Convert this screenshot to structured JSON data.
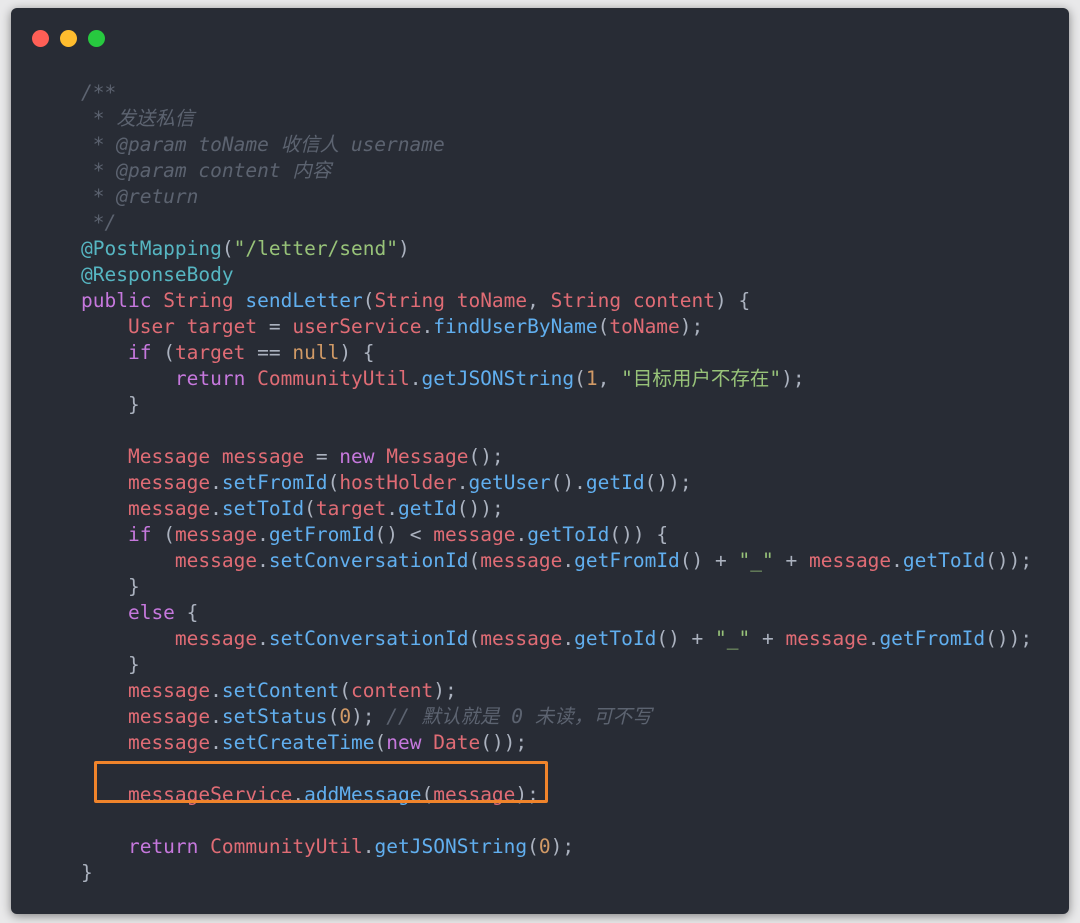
{
  "window": {
    "controls": [
      "close",
      "minimize",
      "maximize"
    ],
    "colors": {
      "close": "#ff5f56",
      "minimize": "#ffbd2e",
      "maximize": "#27c93f",
      "background": "#282c35",
      "highlight": "#f0842b"
    }
  },
  "code": {
    "lines": [
      [
        {
          "t": "/**",
          "c": "comment"
        }
      ],
      [
        {
          "t": " * 发送私信",
          "c": "comment"
        }
      ],
      [
        {
          "t": " * @param toName 收信人 username",
          "c": "comment"
        }
      ],
      [
        {
          "t": " * @param content 内容",
          "c": "comment"
        }
      ],
      [
        {
          "t": " * @return",
          "c": "comment"
        }
      ],
      [
        {
          "t": " */",
          "c": "comment"
        }
      ],
      [
        {
          "t": "@PostMapping",
          "c": "ann"
        },
        {
          "t": "(",
          "c": "punc"
        },
        {
          "t": "\"/letter/send\"",
          "c": "str"
        },
        {
          "t": ")",
          "c": "punc"
        }
      ],
      [
        {
          "t": "@ResponseBody",
          "c": "ann"
        }
      ],
      [
        {
          "t": "public ",
          "c": "kw"
        },
        {
          "t": "String ",
          "c": "type"
        },
        {
          "t": "sendLetter",
          "c": "fn"
        },
        {
          "t": "(",
          "c": "punc"
        },
        {
          "t": "String toName",
          "c": "type"
        },
        {
          "t": ", ",
          "c": "punc"
        },
        {
          "t": "String content",
          "c": "type"
        },
        {
          "t": ") {",
          "c": "punc"
        }
      ],
      [
        {
          "t": "    User target ",
          "c": "type"
        },
        {
          "t": "= ",
          "c": "punc"
        },
        {
          "t": "userService",
          "c": "type"
        },
        {
          "t": ".",
          "c": "punc"
        },
        {
          "t": "findUserByName",
          "c": "fn"
        },
        {
          "t": "(",
          "c": "punc"
        },
        {
          "t": "toName",
          "c": "type"
        },
        {
          "t": ");",
          "c": "punc"
        }
      ],
      [
        {
          "t": "    if ",
          "c": "kw"
        },
        {
          "t": "(",
          "c": "punc"
        },
        {
          "t": "target ",
          "c": "type"
        },
        {
          "t": "== ",
          "c": "punc"
        },
        {
          "t": "null",
          "c": "num"
        },
        {
          "t": ") {",
          "c": "punc"
        }
      ],
      [
        {
          "t": "        return ",
          "c": "kw"
        },
        {
          "t": "CommunityUtil",
          "c": "type"
        },
        {
          "t": ".",
          "c": "punc"
        },
        {
          "t": "getJSONString",
          "c": "fn"
        },
        {
          "t": "(",
          "c": "punc"
        },
        {
          "t": "1",
          "c": "num"
        },
        {
          "t": ", ",
          "c": "punc"
        },
        {
          "t": "\"目标用户不存在\"",
          "c": "str"
        },
        {
          "t": ");",
          "c": "punc"
        }
      ],
      [
        {
          "t": "    }",
          "c": "punc"
        }
      ],
      [],
      [
        {
          "t": "    Message message ",
          "c": "type"
        },
        {
          "t": "= ",
          "c": "punc"
        },
        {
          "t": "new ",
          "c": "kw"
        },
        {
          "t": "Message",
          "c": "type"
        },
        {
          "t": "();",
          "c": "punc"
        }
      ],
      [
        {
          "t": "    message",
          "c": "type"
        },
        {
          "t": ".",
          "c": "punc"
        },
        {
          "t": "setFromId",
          "c": "fn"
        },
        {
          "t": "(",
          "c": "punc"
        },
        {
          "t": "hostHolder",
          "c": "type"
        },
        {
          "t": ".",
          "c": "punc"
        },
        {
          "t": "getUser",
          "c": "fn"
        },
        {
          "t": "().",
          "c": "punc"
        },
        {
          "t": "getId",
          "c": "fn"
        },
        {
          "t": "());",
          "c": "punc"
        }
      ],
      [
        {
          "t": "    message",
          "c": "type"
        },
        {
          "t": ".",
          "c": "punc"
        },
        {
          "t": "setToId",
          "c": "fn"
        },
        {
          "t": "(",
          "c": "punc"
        },
        {
          "t": "target",
          "c": "type"
        },
        {
          "t": ".",
          "c": "punc"
        },
        {
          "t": "getId",
          "c": "fn"
        },
        {
          "t": "());",
          "c": "punc"
        }
      ],
      [
        {
          "t": "    if ",
          "c": "kw"
        },
        {
          "t": "(",
          "c": "punc"
        },
        {
          "t": "message",
          "c": "type"
        },
        {
          "t": ".",
          "c": "punc"
        },
        {
          "t": "getFromId",
          "c": "fn"
        },
        {
          "t": "() < ",
          "c": "punc"
        },
        {
          "t": "message",
          "c": "type"
        },
        {
          "t": ".",
          "c": "punc"
        },
        {
          "t": "getToId",
          "c": "fn"
        },
        {
          "t": "()) {",
          "c": "punc"
        }
      ],
      [
        {
          "t": "        message",
          "c": "type"
        },
        {
          "t": ".",
          "c": "punc"
        },
        {
          "t": "setConversationId",
          "c": "fn"
        },
        {
          "t": "(",
          "c": "punc"
        },
        {
          "t": "message",
          "c": "type"
        },
        {
          "t": ".",
          "c": "punc"
        },
        {
          "t": "getFromId",
          "c": "fn"
        },
        {
          "t": "() + ",
          "c": "punc"
        },
        {
          "t": "\"_\"",
          "c": "str"
        },
        {
          "t": " + ",
          "c": "punc"
        },
        {
          "t": "message",
          "c": "type"
        },
        {
          "t": ".",
          "c": "punc"
        },
        {
          "t": "getToId",
          "c": "fn"
        },
        {
          "t": "());",
          "c": "punc"
        }
      ],
      [
        {
          "t": "    }",
          "c": "punc"
        }
      ],
      [
        {
          "t": "    else ",
          "c": "kw"
        },
        {
          "t": "{",
          "c": "punc"
        }
      ],
      [
        {
          "t": "        message",
          "c": "type"
        },
        {
          "t": ".",
          "c": "punc"
        },
        {
          "t": "setConversationId",
          "c": "fn"
        },
        {
          "t": "(",
          "c": "punc"
        },
        {
          "t": "message",
          "c": "type"
        },
        {
          "t": ".",
          "c": "punc"
        },
        {
          "t": "getToId",
          "c": "fn"
        },
        {
          "t": "() + ",
          "c": "punc"
        },
        {
          "t": "\"_\"",
          "c": "str"
        },
        {
          "t": " + ",
          "c": "punc"
        },
        {
          "t": "message",
          "c": "type"
        },
        {
          "t": ".",
          "c": "punc"
        },
        {
          "t": "getFromId",
          "c": "fn"
        },
        {
          "t": "());",
          "c": "punc"
        }
      ],
      [
        {
          "t": "    }",
          "c": "punc"
        }
      ],
      [
        {
          "t": "    message",
          "c": "type"
        },
        {
          "t": ".",
          "c": "punc"
        },
        {
          "t": "setContent",
          "c": "fn"
        },
        {
          "t": "(",
          "c": "punc"
        },
        {
          "t": "content",
          "c": "type"
        },
        {
          "t": ");",
          "c": "punc"
        }
      ],
      [
        {
          "t": "    message",
          "c": "type"
        },
        {
          "t": ".",
          "c": "punc"
        },
        {
          "t": "setStatus",
          "c": "fn"
        },
        {
          "t": "(",
          "c": "punc"
        },
        {
          "t": "0",
          "c": "num"
        },
        {
          "t": "); ",
          "c": "punc"
        },
        {
          "t": "// 默认就是 0 未读，可不写",
          "c": "comment"
        }
      ],
      [
        {
          "t": "    message",
          "c": "type"
        },
        {
          "t": ".",
          "c": "punc"
        },
        {
          "t": "setCreateTime",
          "c": "fn"
        },
        {
          "t": "(",
          "c": "punc"
        },
        {
          "t": "new ",
          "c": "kw"
        },
        {
          "t": "Date",
          "c": "type"
        },
        {
          "t": "());",
          "c": "punc"
        }
      ],
      [],
      [
        {
          "t": "    messageService",
          "c": "type"
        },
        {
          "t": ".",
          "c": "punc"
        },
        {
          "t": "addMessage",
          "c": "fn"
        },
        {
          "t": "(",
          "c": "punc"
        },
        {
          "t": "message",
          "c": "type"
        },
        {
          "t": ");",
          "c": "punc"
        }
      ],
      [],
      [
        {
          "t": "    return ",
          "c": "kw"
        },
        {
          "t": "CommunityUtil",
          "c": "type"
        },
        {
          "t": ".",
          "c": "punc"
        },
        {
          "t": "getJSONString",
          "c": "fn"
        },
        {
          "t": "(",
          "c": "punc"
        },
        {
          "t": "0",
          "c": "num"
        },
        {
          "t": ");",
          "c": "punc"
        }
      ],
      [
        {
          "t": "}",
          "c": "punc"
        }
      ]
    ],
    "highlighted_line_index": 27
  }
}
